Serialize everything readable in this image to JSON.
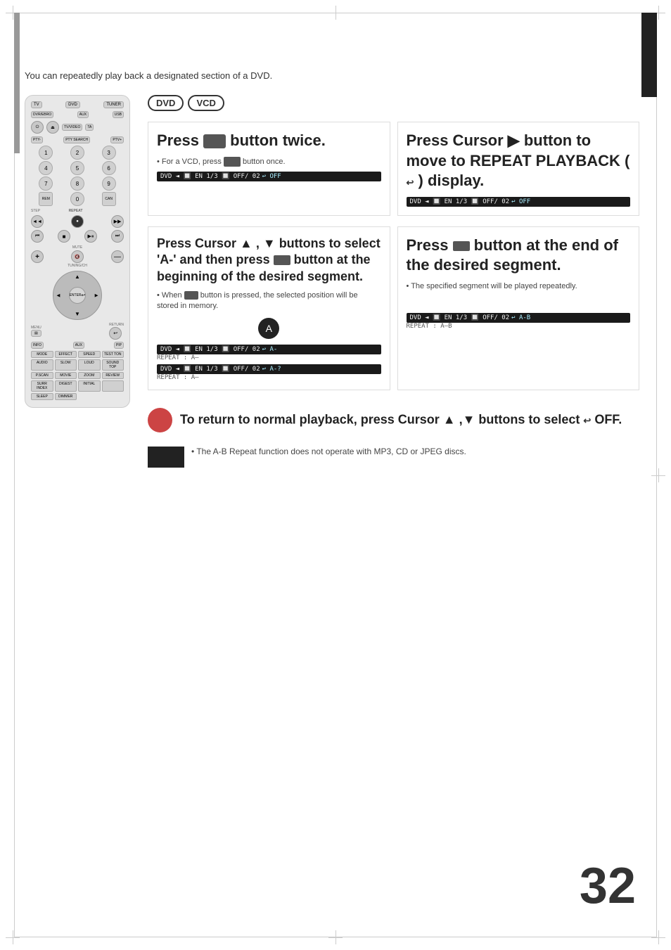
{
  "page": {
    "number": "32",
    "intro": "You can repeatedly play back a designated section of a DVD."
  },
  "badges": {
    "dvd": "DVD",
    "vcd": "VCD"
  },
  "step1": {
    "title": "Press     button twice.",
    "sub_vcd": "• For a VCD, press        button once.",
    "osd": "DVD ◄ 🔲 EN 1/3  🔲 OFF/ 02 🔁 OFF"
  },
  "step2": {
    "title": "Press Cursor ▶ button to move to REPEAT PLAYBACK (🔁) display.",
    "osd": "DVD ◄ 🔲 EN 1/3  🔲 OFF/ 02 🔁 OFF"
  },
  "step3": {
    "title": "Press Cursor ▲ , ▼ buttons to select 'A-' and then press        button at the beginning of the desired segment.",
    "note1": "• When         button is pressed, the selected position will be stored in memory.",
    "osd_a": "DVD ◄ 🔲 EN 1/3  🔲 OFF/ 02 🔁 A-",
    "repeat_a": "REPEAT : A—",
    "osd_a2": "DVD ◄ 🔲 EN 1/3  🔲 OFF/ 02 🔁 A-?",
    "repeat_a2": "REPEAT : A—"
  },
  "step4": {
    "title": "Press        button at the end of the desired segment.",
    "note": "• The specified segment will be played repeatedly.",
    "osd": "DVD ◄ 🔲 EN 1/3  🔲 OFF/ 02 🔁 A-B",
    "repeat_ab": "REPEAT : A—B"
  },
  "bottom": {
    "instruction": "To return to normal playback, press Cursor ▲  ,▼ buttons to select 🔁 OFF.",
    "note": "• The A-B Repeat function does not operate with MP3, CD or JPEG discs."
  },
  "remote": {
    "buttons": {
      "tv": "TV",
      "dvd": "DVD",
      "tuner": "TUNER",
      "dvr_ebro": "DVR/EBRO",
      "aux": "AUX",
      "usb": "USB",
      "power": "⏻",
      "open": "⏏",
      "tv_video": "TV/VIDEO",
      "ta": "TA",
      "pty_minus": "PTY-",
      "pty_search": "PTY SEARCH",
      "ptv_plus": "PTV+",
      "remain": "REMAIN",
      "cancel": "CANCEL",
      "step": "STEP",
      "repeat": "REPEAT",
      "rewind": "◄◄",
      "play": "►",
      "pause": "⏸",
      "fast_fwd": "▶▶",
      "skip_prev": "⏮",
      "stop": "■",
      "skip_next": "⏭",
      "skip_end": "⏭⏭",
      "volume_up": "+",
      "volume_down": "—",
      "mute": "MUTE",
      "tuning_up": "TUNING/CH",
      "menu": "MENU",
      "return": "RETURN",
      "enter": "ENTER",
      "info": "INFO",
      "aux2": "AUX",
      "numbers": [
        "1",
        "2",
        "3",
        "4",
        "5",
        "6",
        "7",
        "8",
        "9",
        "0"
      ],
      "mode": "MODE",
      "effect": "EFFECT",
      "sleep": "SLEEP",
      "dimmer": "DIMMER"
    }
  }
}
